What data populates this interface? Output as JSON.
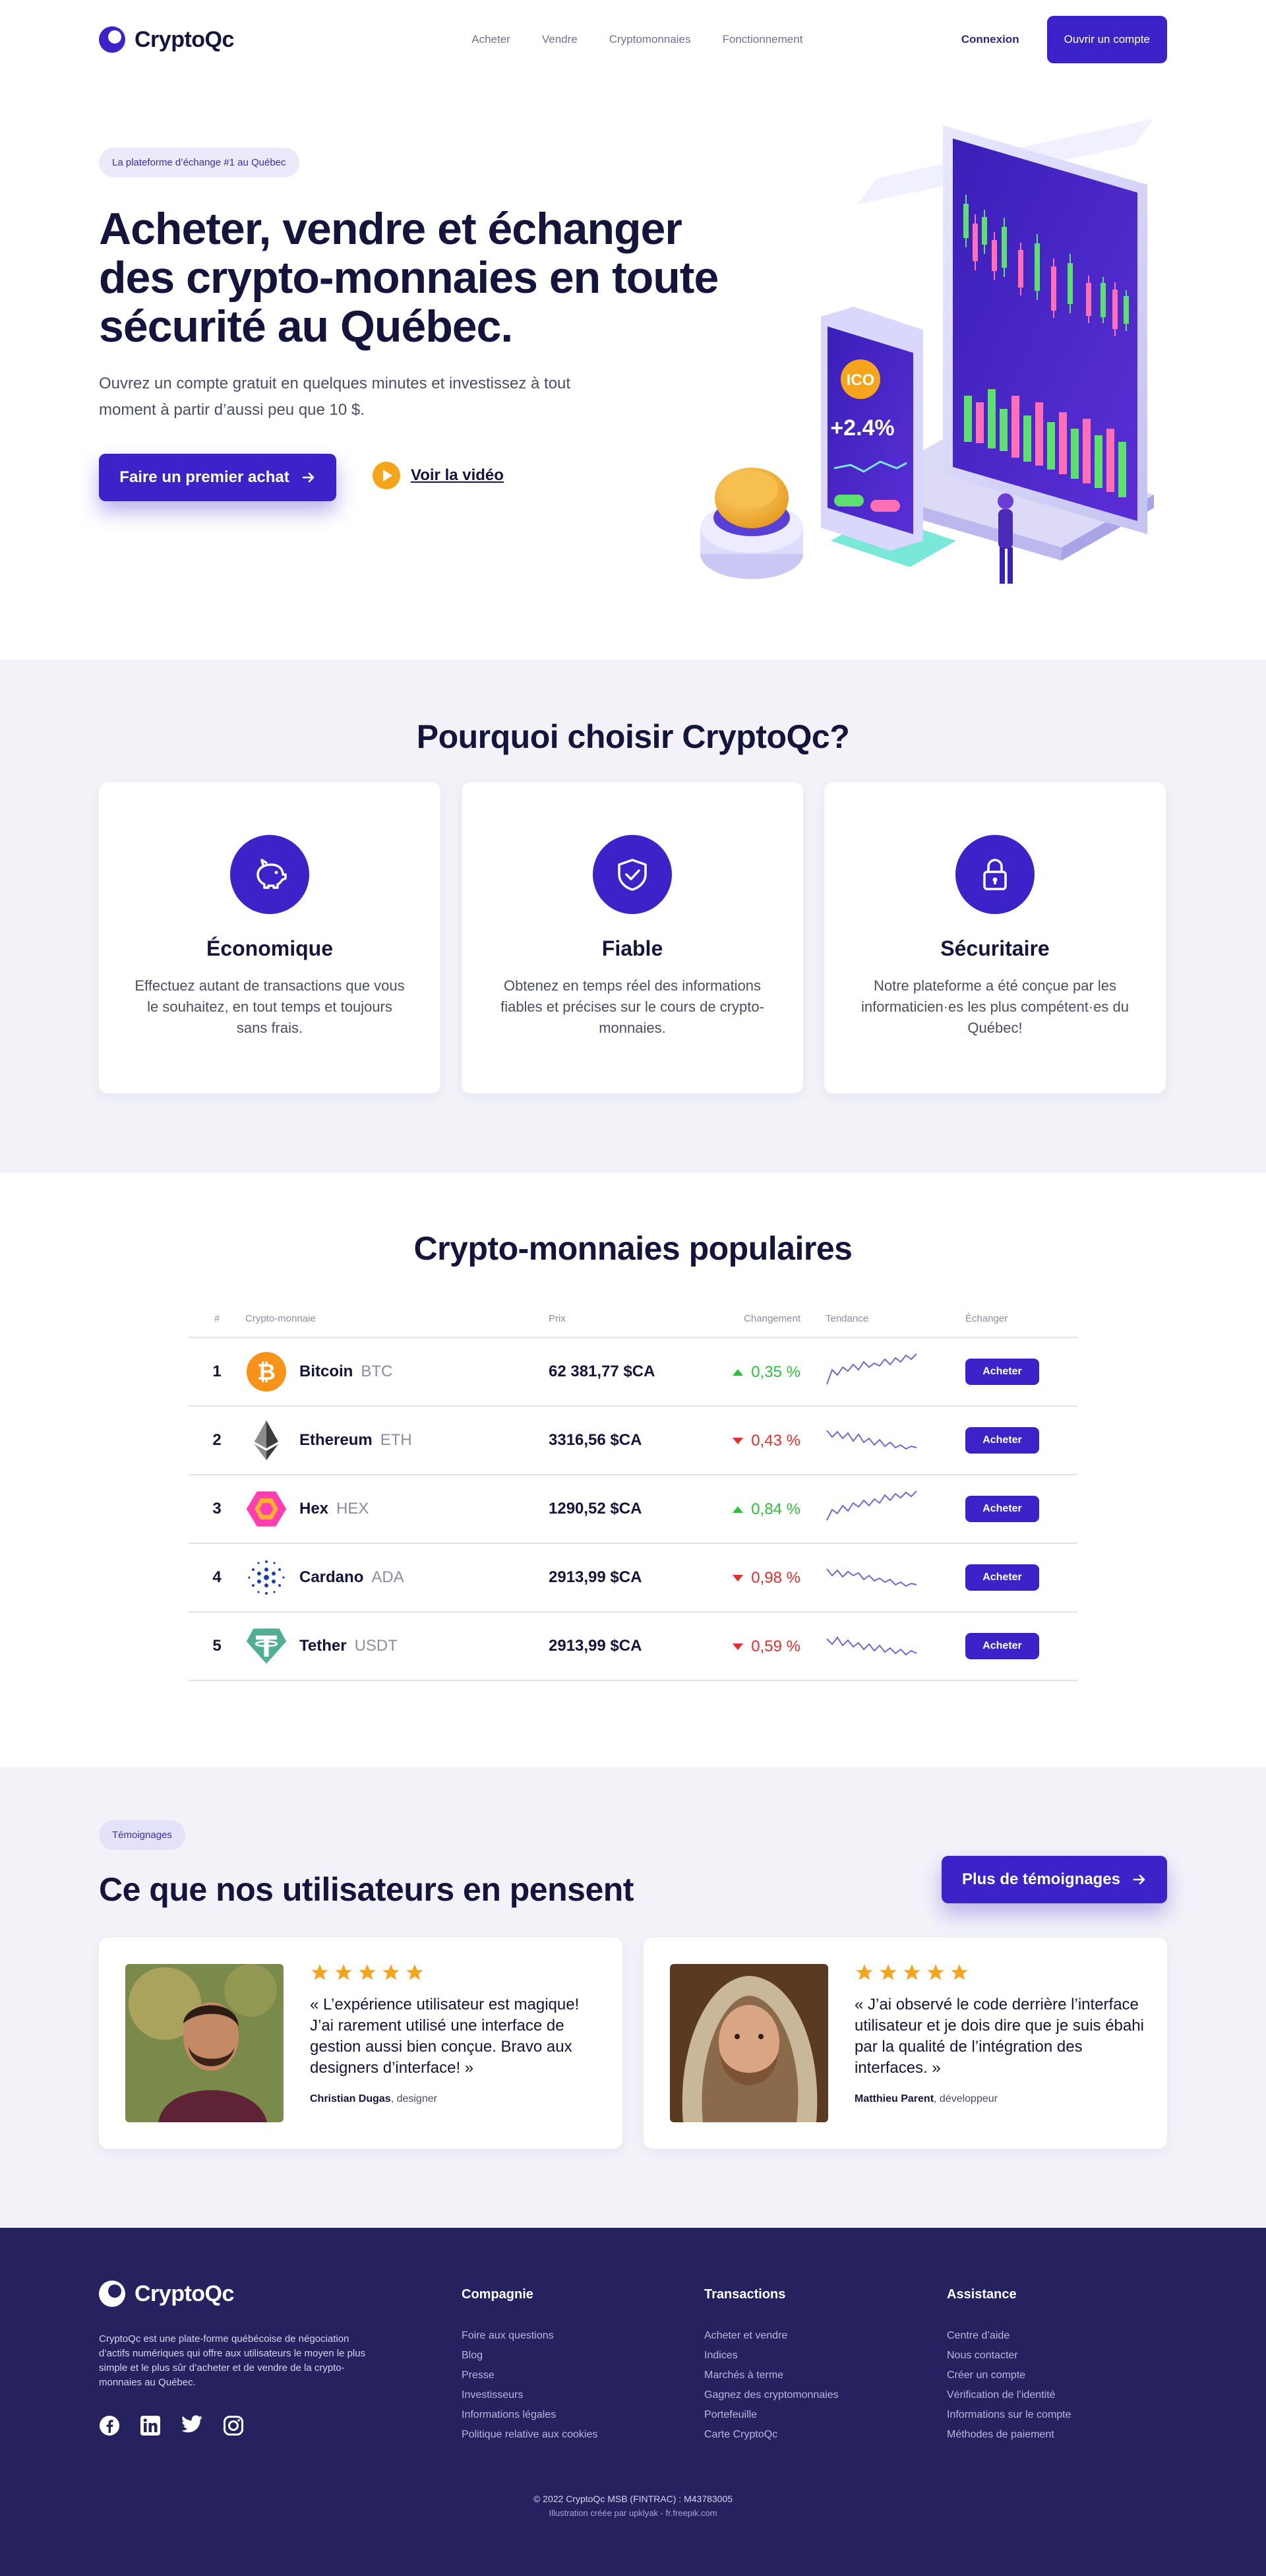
{
  "brand": {
    "name": "CryptoQc"
  },
  "nav": {
    "links": [
      "Acheter",
      "Vendre",
      "Cryptomonnaies",
      "Fonctionnement"
    ],
    "login": "Connexion",
    "signup": "Ouvrir un compte"
  },
  "hero": {
    "badge": "La plateforme d’échange #1 au Québec",
    "title": "Acheter, vendre et échanger des crypto-monnaies en toute sécurité au Québec.",
    "subtitle": "Ouvrez un compte gratuit en quelques minutes et investissez à tout moment à partir d’aussi peu que 10 $.",
    "cta": "Faire un premier achat",
    "video": "Voir la vidéo",
    "art": {
      "coin_label": "ICO",
      "change": "+2.4%"
    }
  },
  "why": {
    "title": "Pourquoi choisir CryptoQc?",
    "cards": [
      {
        "icon": "piggy-bank-icon",
        "title": "Économique",
        "text": "Effectuez autant de transactions que vous le souhaitez, en tout temps et toujours sans frais."
      },
      {
        "icon": "shield-check-icon",
        "title": "Fiable",
        "text": "Obtenez en temps réel des informations fiables et précises sur le cours de crypto-monnaies."
      },
      {
        "icon": "lock-icon",
        "title": "Sécuritaire",
        "text": "Notre plateforme a été conçue par les informaticien·es les plus compétent·es du Québec!"
      }
    ]
  },
  "popular": {
    "title": "Crypto-monnaies populaires",
    "headers": [
      "#",
      "Crypto-monnaie",
      "Prix",
      "Changement",
      "Tendance",
      "Échanger"
    ],
    "rows": [
      {
        "rank": "1",
        "name": "Bitcoin",
        "symbol": "BTC",
        "price": "62 381,77 $CA",
        "change": "0,35 %",
        "direction": "up",
        "icon": "bitcoin-icon",
        "buy": "Acheter"
      },
      {
        "rank": "2",
        "name": "Ethereum",
        "symbol": "ETH",
        "price": "3316,56 $CA",
        "change": "0,43 %",
        "direction": "down",
        "icon": "ethereum-icon",
        "buy": "Acheter"
      },
      {
        "rank": "3",
        "name": "Hex",
        "symbol": "HEX",
        "price": "1290,52 $CA",
        "change": "0,84 %",
        "direction": "up",
        "icon": "hex-icon",
        "buy": "Acheter"
      },
      {
        "rank": "4",
        "name": "Cardano",
        "symbol": "ADA",
        "price": "2913,99 $CA",
        "change": "0,98 %",
        "direction": "down",
        "icon": "cardano-icon",
        "buy": "Acheter"
      },
      {
        "rank": "5",
        "name": "Tether",
        "symbol": "USDT",
        "price": "2913,99 $CA",
        "change": "0,59 %",
        "direction": "down",
        "icon": "tether-icon",
        "buy": "Acheter"
      }
    ]
  },
  "testimonials": {
    "badge": "Témoignages",
    "title": "Ce que nos utilisateurs en pensent",
    "more": "Plus de témoignages",
    "items": [
      {
        "rating": 5,
        "quote": "« L’expérience utilisateur est magique! J’ai rarement utilisé une interface de gestion aussi bien conçue. Bravo aux designers d’interface! »",
        "author": "Christian Dugas",
        "role": ", designer"
      },
      {
        "rating": 5,
        "quote": "« J’ai observé le code derrière l’interface utilisateur et je dois dire que je suis ébahi par la qualité de l’intégration des interfaces. »",
        "author": "Matthieu Parent",
        "role": ", développeur"
      }
    ]
  },
  "footer": {
    "description": "CryptoQc est une plate-forme québécoise de négociation d’actifs numériques qui offre aux utilisateurs le moyen le plus simple et le plus sûr d’acheter et de vendre de la crypto-monnaies au Québec.",
    "social": [
      "facebook-icon",
      "linkedin-icon",
      "twitter-icon",
      "instagram-icon"
    ],
    "columns": [
      {
        "title": "Compagnie",
        "links": [
          "Foire aux questions",
          "Blog",
          "Presse",
          "Investisseurs",
          "Informations légales",
          "Politique relative aux cookies"
        ]
      },
      {
        "title": "Transactions",
        "links": [
          "Acheter et vendre",
          "Indices",
          "Marchés à terme",
          "Gagnez des cryptomonnaies",
          "Portefeuille",
          "Carte CryptoQc"
        ]
      },
      {
        "title": "Assistance",
        "links": [
          "Centre d’aide",
          "Nous contacter",
          "Créer un compte",
          "Vérification de l’identité",
          "Informations sur le compte",
          "Méthodes de paiement"
        ]
      }
    ],
    "copyright": "© 2022 CryptoQc MSB (FINTRAC) : M43783005",
    "credit": "Illustration créée par upklyak - fr.freepik.com"
  },
  "colors": {
    "primary": "#3b22c9",
    "dark": "#14143c",
    "footer_bg": "#26215f",
    "section_bg": "#f2f2f8",
    "up": "#2fbf3c",
    "down": "#e0302c",
    "star": "#f4a51c"
  }
}
